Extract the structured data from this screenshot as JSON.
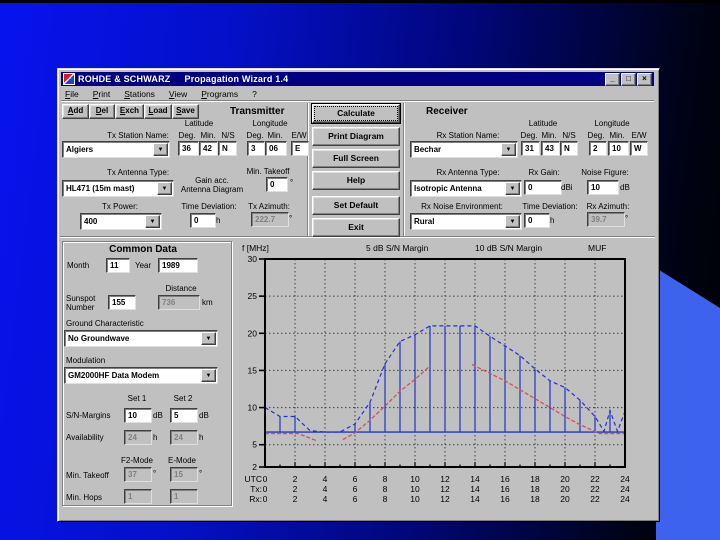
{
  "window": {
    "title_brand": "ROHDE & SCHWARZ",
    "title_app": "Propagation Wizard 1.4",
    "controls": {
      "minimize": "_",
      "maximize": "□",
      "close": "×"
    }
  },
  "menu": {
    "items": [
      "File",
      "Print",
      "Stations",
      "View",
      "Programs",
      "?"
    ]
  },
  "toolbar": {
    "items": [
      "Add",
      "Del",
      "Exch",
      "Load",
      "Save"
    ]
  },
  "actions": {
    "calculate": "Calculate",
    "print_diagram": "Print Diagram",
    "full_screen": "Full Screen",
    "help": "Help",
    "set_default": "Set Default",
    "exit": "Exit"
  },
  "units": {
    "deg": "°",
    "hour": "h",
    "db": "dB",
    "dbi": "dBi",
    "km": "km"
  },
  "transmitter": {
    "heading": "Transmitter",
    "station_label": "Tx Station Name:",
    "station_value": "Algiers",
    "lat_label": "Latitude",
    "lon_label": "Longitude",
    "col_deg": "Deg.",
    "col_min": "Min.",
    "col_ns": "N/S",
    "col_ew": "E/W",
    "lat_deg": "36",
    "lat_min": "42",
    "lat_ns": "N",
    "lon_deg": "3",
    "lon_min": "06",
    "lon_ew": "E",
    "antenna_label": "Tx Antenna Type:",
    "antenna_value": "HL471 (15m mast)",
    "gain_label_1": "Gain acc.",
    "gain_label_2": "Antenna Diagram",
    "takeoff_label": "Min. Takeoff",
    "takeoff_value": "0",
    "power_label": "Tx Power:",
    "power_value": "400",
    "timedev_label": "Time Deviation:",
    "timedev_value": "0",
    "azimuth_label": "Tx Azimuth:",
    "azimuth_value": "222.7"
  },
  "receiver": {
    "heading": "Receiver",
    "station_label": "Rx Station Name:",
    "station_value": "Bechar",
    "lat_label": "Latitude",
    "lon_label": "Longitude",
    "col_deg": "Deg.",
    "col_min": "Min.",
    "col_ns": "N/S",
    "col_ew": "E/W",
    "lat_deg": "31",
    "lat_min": "43",
    "lat_ns": "N",
    "lon_deg": "2",
    "lon_min": "10",
    "lon_ew": "W",
    "antenna_label": "Rx Antenna Type:",
    "antenna_value": "Isotropic Antenna",
    "gain_label": "Rx Gain:",
    "gain_value": "0",
    "nf_label": "Noise Figure:",
    "nf_value": "10",
    "noise_env_label": "Rx Noise Environment:",
    "noise_env_value": "Rural",
    "timedev_label": "Time Deviation:",
    "timedev_value": "0",
    "azimuth_label": "Rx Azimuth:",
    "azimuth_value": "39.7"
  },
  "common": {
    "heading": "Common Data",
    "month_label": "Month",
    "month_value": "11",
    "year_label": "Year",
    "year_value": "1989",
    "sunspot_label_1": "Sunspot",
    "sunspot_label_2": "Number",
    "sunspot_value": "155",
    "distance_label": "Distance",
    "distance_value": "736",
    "ground_label": "Ground Characteristic",
    "ground_value": "No Groundwave",
    "modulation_label": "Modulation",
    "modulation_value": "GM2000HF Data Modem",
    "set1_label": "Set 1",
    "set2_label": "Set 2",
    "sn_label": "S/N-Margins",
    "sn1_value": "10",
    "sn2_value": "5",
    "avail_label": "Availability",
    "avail1_value": "24",
    "avail2_value": "24",
    "f2_label": "F2-Mode",
    "e_label": "E-Mode",
    "takeoff_label": "Min. Takeoff",
    "takeoff_f2": "37",
    "takeoff_e": "15",
    "hops_label": "Min. Hops",
    "hops_f2": "1",
    "hops_e": "1"
  },
  "chart_data": {
    "type": "line",
    "ylabel": "f [MHz]",
    "legend": [
      "5 dB S/N Margin",
      "10 dB S/N Margin",
      "MUF"
    ],
    "ylim": [
      2,
      30
    ],
    "yticks": [
      30,
      25,
      20,
      15,
      10,
      5,
      2
    ],
    "grid_yticks": [
      25,
      20,
      15,
      10,
      5
    ],
    "xlim": [
      0,
      24
    ],
    "xticks": [
      0,
      2,
      4,
      6,
      8,
      10,
      12,
      14,
      16,
      18,
      20,
      22,
      24
    ],
    "grid_xticks": [
      2,
      4,
      6,
      8,
      10,
      12,
      14,
      16,
      18,
      20,
      22
    ],
    "grid": true,
    "axis_rows": [
      {
        "label": "UTC",
        "values": [
          0,
          2,
          4,
          6,
          8,
          10,
          12,
          14,
          16,
          18,
          20,
          22,
          24
        ]
      },
      {
        "label": "Tx:",
        "values": [
          0,
          2,
          4,
          6,
          8,
          10,
          12,
          14,
          16,
          18,
          20,
          22,
          24
        ]
      },
      {
        "label": "Rx:",
        "values": [
          0,
          2,
          4,
          6,
          8,
          10,
          12,
          14,
          16,
          18,
          20,
          22,
          24
        ]
      }
    ],
    "muf": {
      "name": "MUF",
      "color": "#2233cc",
      "style": "dashed",
      "points": [
        [
          0,
          10
        ],
        [
          1,
          8.8
        ],
        [
          2,
          8.8
        ],
        [
          3,
          6.9
        ],
        [
          4,
          6.7
        ],
        [
          5,
          6.7
        ],
        [
          6,
          7.8
        ],
        [
          7,
          10.7
        ],
        [
          8,
          15.9
        ],
        [
          9,
          18.9
        ],
        [
          10,
          19.8
        ],
        [
          11,
          21
        ],
        [
          14,
          21
        ],
        [
          15,
          19.6
        ],
        [
          16,
          18.3
        ],
        [
          17,
          17
        ],
        [
          18,
          15.2
        ],
        [
          19,
          13.6
        ],
        [
          20,
          12.7
        ],
        [
          21,
          11
        ],
        [
          22,
          8.8
        ],
        [
          22.6,
          6.8
        ],
        [
          23,
          9.6
        ],
        [
          23.5,
          6.8
        ],
        [
          24,
          9.5
        ]
      ]
    },
    "sn_margin": {
      "name": "S/N margin",
      "color": "#cc5555",
      "style": "dashed",
      "segments": [
        [
          [
            0,
            6.5
          ],
          [
            2.2,
            6.5
          ],
          [
            3.5,
            5.5
          ]
        ],
        [
          [
            5.2,
            5.7
          ],
          [
            6,
            6.6
          ],
          [
            7,
            8.3
          ],
          [
            8,
            10.2
          ],
          [
            9,
            12.2
          ],
          [
            10,
            13.8
          ],
          [
            11,
            15.6
          ]
        ],
        [
          [
            13.8,
            15.8
          ],
          [
            15,
            14.6
          ],
          [
            16,
            13.6
          ],
          [
            17,
            12.4
          ],
          [
            18,
            11.2
          ],
          [
            19,
            10
          ],
          [
            20,
            8.8
          ],
          [
            21,
            7.7
          ],
          [
            22.3,
            6.5
          ],
          [
            24,
            6.5
          ]
        ]
      ]
    },
    "baseline": {
      "color": "#2233cc",
      "freq": 6.7
    },
    "hatch": {
      "color": "#2233cc",
      "columns": [
        [
          1,
          8.8
        ],
        [
          2,
          8.8
        ],
        [
          6,
          7.8
        ],
        [
          7,
          10.7
        ],
        [
          8,
          15.9
        ],
        [
          9,
          18.9
        ],
        [
          10,
          19.8
        ],
        [
          11,
          21
        ],
        [
          12,
          21
        ],
        [
          13,
          21
        ],
        [
          14,
          21
        ],
        [
          15,
          19.6
        ],
        [
          16,
          18.3
        ],
        [
          17,
          17
        ],
        [
          18,
          15.2
        ],
        [
          19,
          13.6
        ],
        [
          20,
          12.7
        ],
        [
          21,
          11
        ],
        [
          22,
          8.8
        ],
        [
          23,
          9.6
        ],
        [
          24,
          9.5
        ]
      ]
    }
  }
}
